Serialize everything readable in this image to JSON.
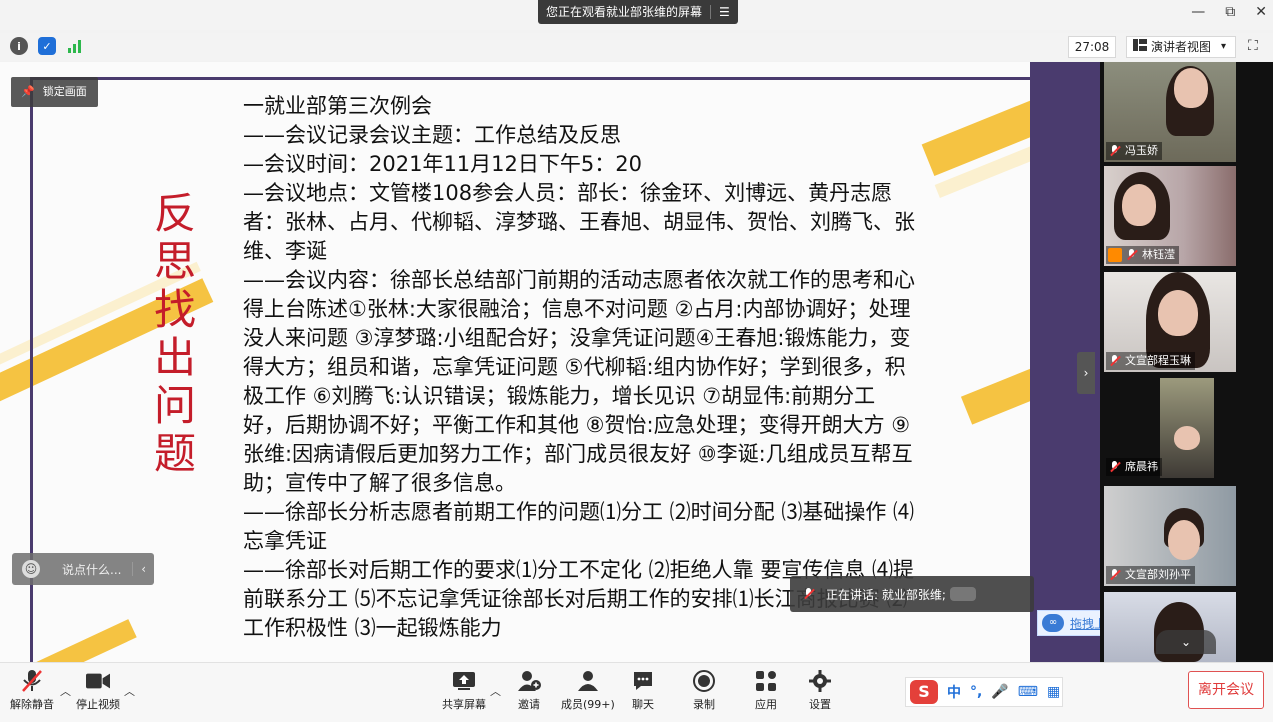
{
  "banner": {
    "text": "您正在观看就业部张维的屏幕",
    "menu_icon": "menu-icon"
  },
  "window_controls": {
    "minimize": "—",
    "restore": "⧉",
    "close": "✕"
  },
  "toolbar2": {
    "timer": "27:08",
    "view_label": "演讲者视图",
    "view_caret": "▾",
    "fullscreen": "⛶"
  },
  "slide": {
    "lock_label": "锁定画面",
    "vertical_title": "反思找出问题",
    "lines": [
      "一就业部第三次例会",
      " ——会议记录会议主题：工作总结及反思",
      "—会议时间：2021年11月12日下午5：20",
      "—会议地点：文管楼108参会人员：部长：徐金环、刘博远、黄丹志愿者：张林、占月、代柳韬、淳梦璐、王春旭、胡显伟、贺怡、刘腾飞、张维、李诞",
      "——会议内容：徐部长总结部门前期的活动志愿者依次就工作的思考和心得上台陈述①张林:大家很融洽；信息不对问题 ②占月:内部协调好；处理没人来问题 ③淳梦璐:小组配合好；没拿凭证问题④王春旭:锻炼能力，变得大方；组员和谐，忘拿凭证问题 ⑤代柳韬:组内协作好；学到很多，积极工作 ⑥刘腾飞:认识错误；锻炼能力，增长见识 ⑦胡显伟:前期分工好，后期协调不好；平衡工作和其他 ⑧贺怡:应急处理；变得开朗大方 ⑨张维:因病请假后更加努力工作；部门成员很友好 ⑩李诞:几组成员互帮互助；宣传中了解了很多信息。",
      "——徐部长分析志愿者前期工作的问题⑴分工 ⑵时间分配 ⑶基础操作 ⑷忘拿凭证",
      "——徐部长对后期工作的要求⑴分工不定化 ⑵拒绝人靠 要宣传信息 ⑷提前联系分工 ⑸不忘记拿凭证徐部长对后期工作的安排⑴长江商报比赛 ⑵工作积极性 ⑶一起锻炼能力"
    ],
    "chat_placeholder": "说点什么...",
    "chat_arrow": "‹",
    "speaking_text": "正在讲话: 就业部张维;",
    "upload_label": "拖拽上传",
    "collapse_arrow": "›"
  },
  "participants": [
    {
      "name": "冯玉娇"
    },
    {
      "name": "林钰滢"
    },
    {
      "name": "文宣部程玉琳"
    },
    {
      "name": "席晨祎"
    },
    {
      "name": "文宣部刘孙平"
    },
    {
      "name": ""
    }
  ],
  "participants_expand": "⌄",
  "bottombar": {
    "unmute": "解除静音",
    "stop_video": "停止视频",
    "share_screen": "共享屏幕",
    "invite": "邀请",
    "members": "成员(99+)",
    "chat": "聊天",
    "record": "录制",
    "apps": "应用",
    "settings": "设置",
    "leave": "离开会议",
    "ime_lang": "中",
    "ime_punct": "°,"
  },
  "colors": {
    "accent_red": "#e03b3b",
    "slide_purple": "#4a3b6e",
    "slide_gold": "#f5c342",
    "title_red": "#c41d2a"
  }
}
